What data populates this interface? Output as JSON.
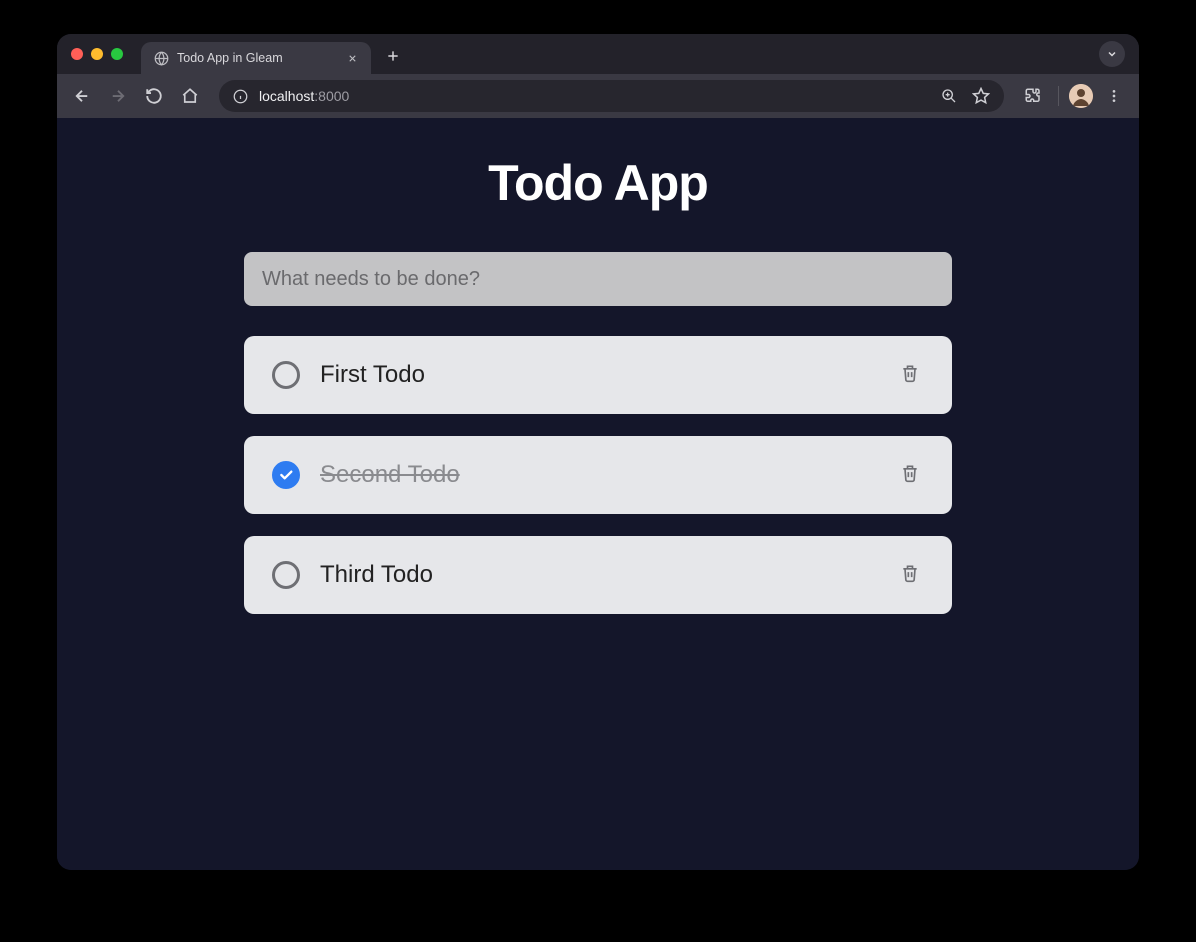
{
  "browser": {
    "tab_title": "Todo App in Gleam",
    "url_host": "localhost",
    "url_port": ":8000"
  },
  "page": {
    "title": "Todo App",
    "input_placeholder": "What needs to be done?"
  },
  "todos": [
    {
      "text": "First Todo",
      "completed": false
    },
    {
      "text": "Second Todo",
      "completed": true
    },
    {
      "text": "Third Todo",
      "completed": false
    }
  ],
  "colors": {
    "accent": "#2e7cf1",
    "page_bg": "#14162a",
    "card_bg": "#e6e7ea"
  }
}
